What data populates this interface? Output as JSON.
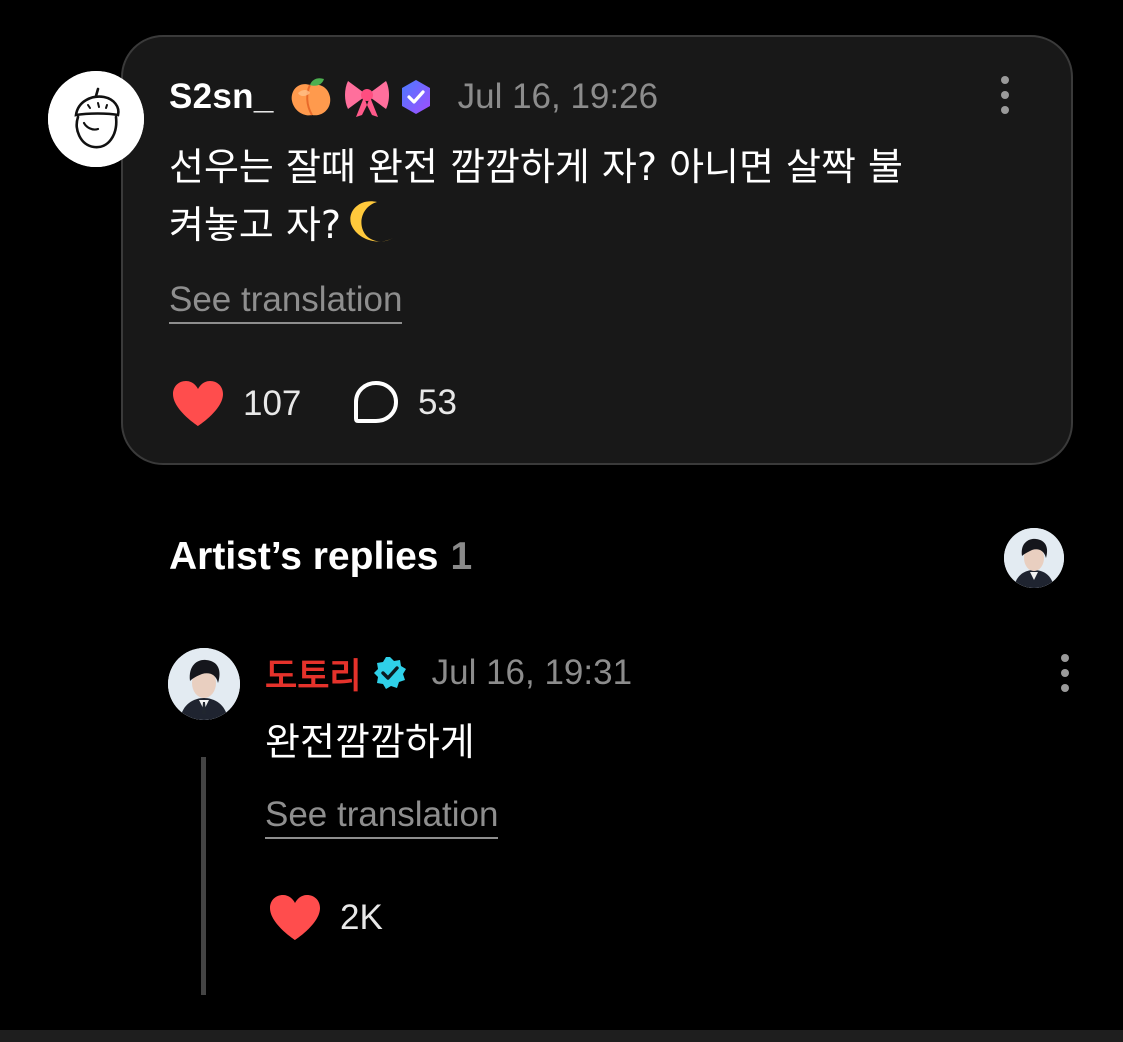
{
  "post": {
    "username": "S2sn_",
    "emojis": [
      "peach",
      "ribbon"
    ],
    "badge": "membership-badge-icon",
    "timestamp": "Jul 16, 19:26",
    "text_line1": "선우는 잘때 완전 깜깜하게 자? 아니면 살짝 불",
    "text_line2": "켜놓고 자?",
    "text_emoji": "crescent-moon",
    "see_translation": "See translation",
    "likes": "107",
    "comments": "53"
  },
  "artist_replies": {
    "title": "Artist’s replies",
    "count": "1"
  },
  "reply": {
    "artist_name": "도토리",
    "timestamp": "Jul 16, 19:31",
    "text": "완전깜깜하게",
    "see_translation": "See translation",
    "likes": "2K"
  },
  "colors": {
    "background": "#000000",
    "card": "#181818",
    "heart": "#ff4d4d",
    "artist_name": "#e5322b",
    "verified": "#2fd0e8",
    "membership_badge": "#7c5cff",
    "muted_text": "#8c8c8c"
  }
}
